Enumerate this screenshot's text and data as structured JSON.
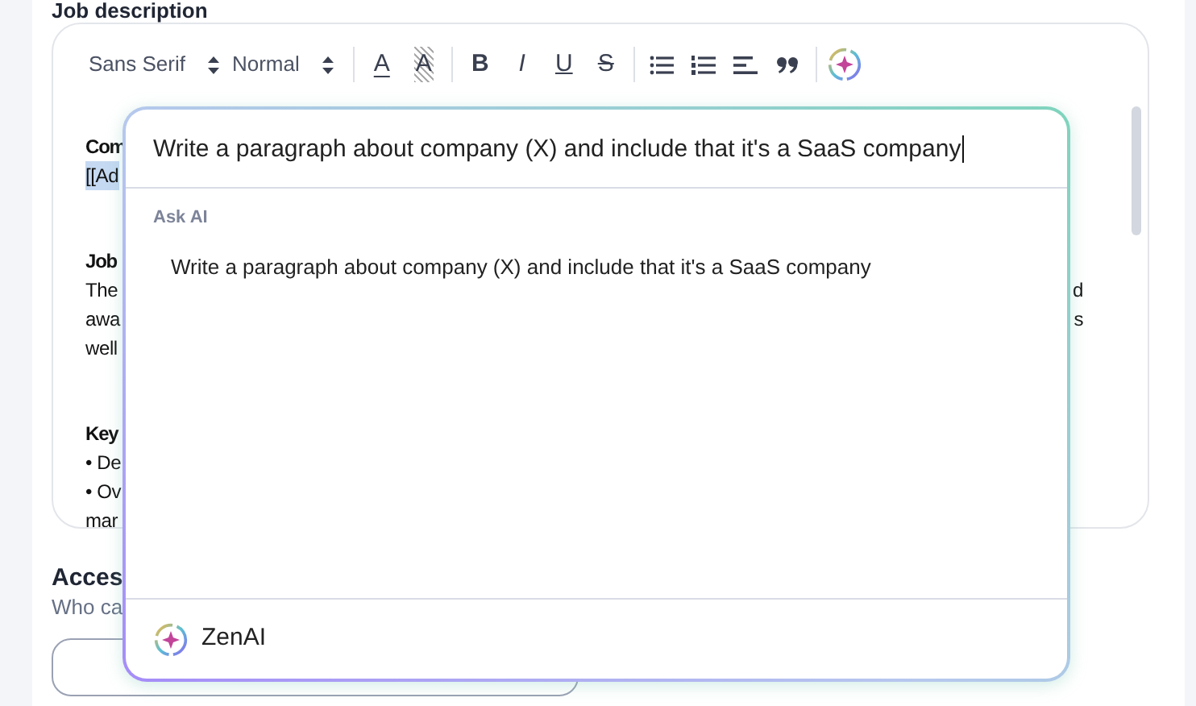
{
  "page_title": "Job description",
  "editor": {
    "toolbar": [
      {
        "kind": "select",
        "label": "Sans Serif"
      },
      {
        "kind": "select",
        "label": "Normal"
      },
      {
        "kind": "color",
        "label": "A"
      },
      {
        "kind": "background",
        "label": "A"
      },
      {
        "kind": "bold",
        "label": "B"
      },
      {
        "kind": "italic",
        "label": "I"
      },
      {
        "kind": "underline",
        "label": "U"
      },
      {
        "kind": "strike",
        "label": "S"
      },
      {
        "kind": "bullet-list"
      },
      {
        "kind": "ordered-list"
      },
      {
        "kind": "align"
      },
      {
        "kind": "quote"
      },
      {
        "kind": "ai"
      }
    ],
    "blocks": [
      [
        {
          "left": "Com",
          "bold": true,
          "highlighted": false
        },
        {
          "left": "[[Ad",
          "bold": false,
          "highlighted": true
        }
      ],
      [
        {
          "left": "Job",
          "bold": true,
          "highlighted": false
        },
        {
          "left": "The",
          "right": "d",
          "bold": false,
          "highlighted": false
        },
        {
          "left": "awa",
          "right": "s",
          "bold": false,
          "highlighted": false
        },
        {
          "left": "well",
          "bold": false,
          "highlighted": false
        }
      ],
      [
        {
          "left": "Key",
          "bold": true,
          "highlighted": false
        },
        {
          "left": "• De",
          "bold": false,
          "highlighted": false
        },
        {
          "left": "• Ov",
          "bold": false,
          "highlighted": false
        },
        {
          "left": "mar",
          "bold": false,
          "highlighted": false
        }
      ]
    ]
  },
  "ai_popup": {
    "prompt": "Write a paragraph about company (X) and include that it's a SaaS company",
    "section_label": "Ask AI",
    "suggestions": [
      "Write a paragraph about company (X) and include that it's a SaaS company"
    ],
    "footer": "ZenAI"
  },
  "access": {
    "title": "Acces",
    "subtitle": "Who ca"
  }
}
